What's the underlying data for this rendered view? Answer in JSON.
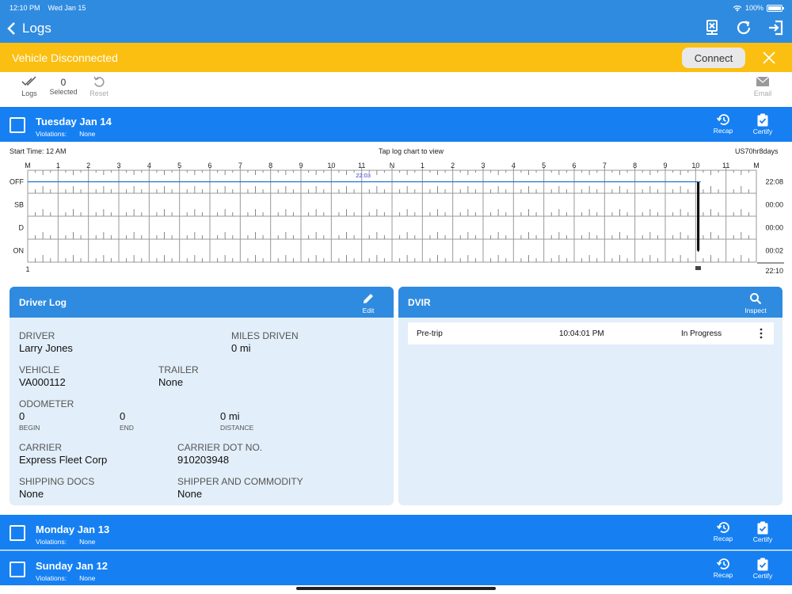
{
  "status": {
    "time": "12:10 PM",
    "date": "Wed Jan 15",
    "battery": "100%",
    "battery_level": 1.0
  },
  "nav": {
    "title": "Logs",
    "back_icon": "chevron-left-icon",
    "actions": [
      "device-x-icon",
      "refresh-icon",
      "logout-icon"
    ]
  },
  "banner": {
    "text": "Vehicle Disconnected",
    "button": "Connect",
    "color": "#fbbf11"
  },
  "toolbar": {
    "logs_label": "Logs",
    "selected_count": "0",
    "selected_label": "Selected",
    "reset_label": "Reset",
    "email_label": "Email"
  },
  "days": [
    {
      "date": "Tuesday Jan 14",
      "violations_label": "Violations:",
      "violations": "None",
      "recap": "Recap",
      "certify": "Certify"
    },
    {
      "date": "Monday Jan 13",
      "violations_label": "Violations:",
      "violations": "None",
      "recap": "Recap",
      "certify": "Certify"
    },
    {
      "date": "Sunday Jan 12",
      "violations_label": "Violations:",
      "violations": "None",
      "recap": "Recap",
      "certify": "Certify"
    }
  ],
  "chart_meta": {
    "start_time": "Start Time: 12 AM",
    "hint": "Tap log chart to view",
    "ruleset": "US70hr8days"
  },
  "chart_data": {
    "type": "line",
    "hour_labels": [
      "M",
      "1",
      "2",
      "3",
      "4",
      "5",
      "6",
      "7",
      "8",
      "9",
      "10",
      "11",
      "N",
      "1",
      "2",
      "3",
      "4",
      "5",
      "6",
      "7",
      "8",
      "9",
      "10",
      "11",
      "M"
    ],
    "status_rows": [
      "OFF",
      "SB",
      "D",
      "ON"
    ],
    "totals": [
      "22:08",
      "00:00",
      "00:00",
      "00:02"
    ],
    "total_sum": "22:10",
    "segments": [
      {
        "status": "OFF",
        "start_hour": 0,
        "end_hour": 22.07
      },
      {
        "status": "ON",
        "start_hour": 22.07,
        "end_hour": 22.1
      },
      {
        "status": "OFF",
        "start_hour": 22.1,
        "end_hour": 22.17
      }
    ],
    "off_bubble": "22:03",
    "bottom_left_label": "1",
    "line_color": "#1a75d1"
  },
  "driver_log": {
    "title": "Driver Log",
    "edit": "Edit",
    "driver_label": "DRIVER",
    "driver": "Larry Jones",
    "miles_label": "MILES DRIVEN",
    "miles": "0 mi",
    "vehicle_label": "VEHICLE",
    "vehicle": "VA000112",
    "trailer_label": "TRAILER",
    "trailer": "None",
    "odometer_label": "ODOMETER",
    "begin": "0",
    "begin_label": "BEGIN",
    "end": "0",
    "end_label": "END",
    "distance": "0 mi",
    "distance_label": "DISTANCE",
    "carrier_label": "CARRIER",
    "carrier": "Express Fleet Corp",
    "dot_label": "CARRIER DOT NO.",
    "dot": "910203948",
    "shipping_label": "SHIPPING DOCS",
    "shipping": "None",
    "commodity_label": "SHIPPER AND COMMODITY",
    "commodity": "None"
  },
  "dvir": {
    "title": "DVIR",
    "inspect": "Inspect",
    "rows": [
      {
        "type": "Pre-trip",
        "time": "10:04:01 PM",
        "status": "In Progress"
      }
    ]
  }
}
